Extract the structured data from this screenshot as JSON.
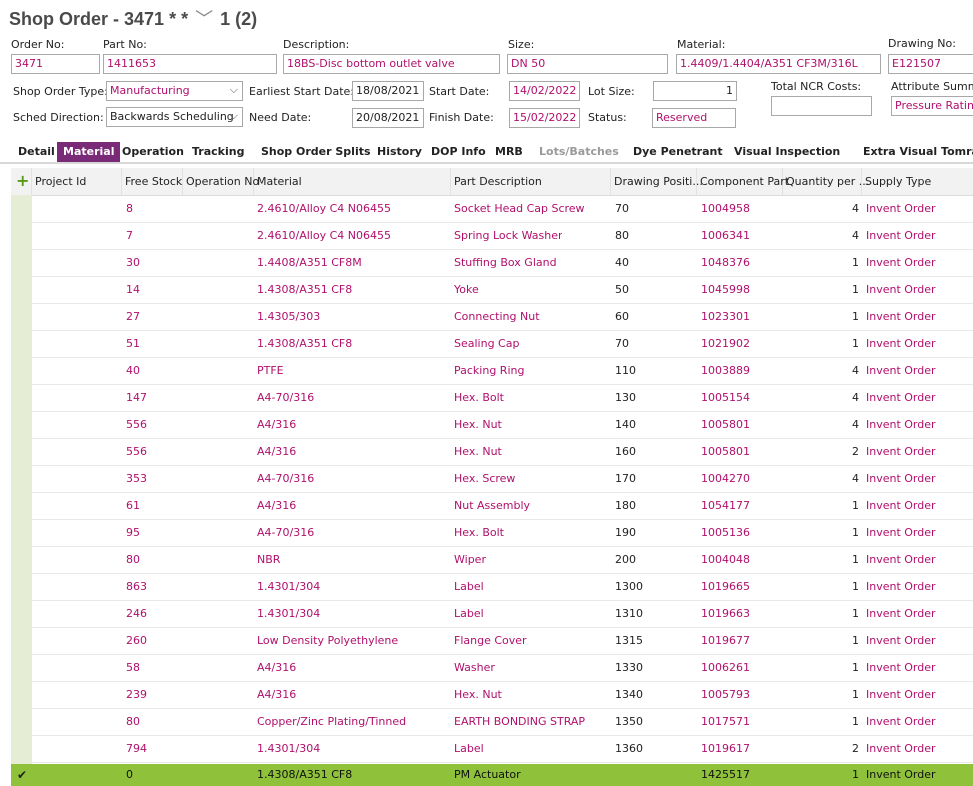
{
  "header": {
    "title": "Shop Order - 3471",
    "stars": "* *",
    "nav": "1 (2)"
  },
  "fields": {
    "order_no": {
      "label": "Order No:",
      "value": "3471"
    },
    "part_no": {
      "label": "Part No:",
      "value": "1411653"
    },
    "description": {
      "label": "Description:",
      "value": "18BS-Disc bottom outlet valve"
    },
    "size": {
      "label": "Size:",
      "value": "DN 50"
    },
    "material": {
      "label": "Material:",
      "value": "1.4409/1.4404/A351 CF3M/316L"
    },
    "drawing_no": {
      "label": "Drawing No:",
      "value": "E121507"
    },
    "shop_order_type": {
      "label": "Shop Order Type:",
      "value": "Manufacturing"
    },
    "earliest_start": {
      "label": "Earliest Start Date:",
      "value": "18/08/2021"
    },
    "start_date": {
      "label": "Start Date:",
      "value": "14/02/2022"
    },
    "lot_size": {
      "label": "Lot Size:",
      "value": "1"
    },
    "total_ncr": {
      "label": "Total NCR Costs:",
      "value": ""
    },
    "attribute_summary": {
      "label": "Attribute Summar",
      "value": "Pressure Rating"
    },
    "sched_direction": {
      "label": "Sched Direction:",
      "value": "Backwards Scheduling"
    },
    "need_date": {
      "label": "Need Date:",
      "value": "20/08/2021"
    },
    "finish_date": {
      "label": "Finish Date:",
      "value": "15/02/2022"
    },
    "status": {
      "label": "Status:",
      "value": "Reserved"
    }
  },
  "tabs": [
    "Detail",
    "Material",
    "Operation",
    "Tracking",
    "Shop Order Splits",
    "History",
    "DOP Info",
    "MRB",
    "Lots/Batches",
    "Dye Penetrant",
    "Visual Inspection",
    "Extra Visual Tomra C"
  ],
  "active_tab": "Material",
  "columns": [
    "Project Id",
    "Free Stock",
    "Operation No",
    "Material",
    "Part Description",
    "Drawing Positi...",
    "Component Part",
    "Quantity per ...",
    "Supply Type"
  ],
  "rows": [
    {
      "free": "8",
      "material": "2.4610/Alloy C4 N06455",
      "desc": "Socket Head Cap Screw",
      "pos": "70",
      "part": "1004958",
      "qty": "4",
      "supply": "Invent Order"
    },
    {
      "free": "7",
      "material": "2.4610/Alloy C4 N06455",
      "desc": "Spring Lock Washer",
      "pos": "80",
      "part": "1006341",
      "qty": "4",
      "supply": "Invent Order"
    },
    {
      "free": "30",
      "material": "1.4408/A351 CF8M",
      "desc": "Stuffing Box Gland",
      "pos": "40",
      "part": "1048376",
      "qty": "1",
      "supply": "Invent Order"
    },
    {
      "free": "14",
      "material": "1.4308/A351 CF8",
      "desc": "Yoke",
      "pos": "50",
      "part": "1045998",
      "qty": "1",
      "supply": "Invent Order"
    },
    {
      "free": "27",
      "material": "1.4305/303",
      "desc": "Connecting Nut",
      "pos": "60",
      "part": "1023301",
      "qty": "1",
      "supply": "Invent Order"
    },
    {
      "free": "51",
      "material": "1.4308/A351 CF8",
      "desc": "Sealing Cap",
      "pos": "70",
      "part": "1021902",
      "qty": "1",
      "supply": "Invent Order"
    },
    {
      "free": "40",
      "material": "PTFE",
      "desc": "Packing Ring",
      "pos": "110",
      "part": "1003889",
      "qty": "4",
      "supply": "Invent Order"
    },
    {
      "free": "147",
      "material": "A4-70/316",
      "desc": "Hex. Bolt",
      "pos": "130",
      "part": "1005154",
      "qty": "4",
      "supply": "Invent Order"
    },
    {
      "free": "556",
      "material": "A4/316",
      "desc": "Hex. Nut",
      "pos": "140",
      "part": "1005801",
      "qty": "4",
      "supply": "Invent Order"
    },
    {
      "free": "556",
      "material": "A4/316",
      "desc": "Hex. Nut",
      "pos": "160",
      "part": "1005801",
      "qty": "2",
      "supply": "Invent Order"
    },
    {
      "free": "353",
      "material": "A4-70/316",
      "desc": "Hex. Screw",
      "pos": "170",
      "part": "1004270",
      "qty": "4",
      "supply": "Invent Order"
    },
    {
      "free": "61",
      "material": "A4/316",
      "desc": "Nut Assembly",
      "pos": "180",
      "part": "1054177",
      "qty": "1",
      "supply": "Invent Order"
    },
    {
      "free": "95",
      "material": "A4-70/316",
      "desc": "Hex. Bolt",
      "pos": "190",
      "part": "1005136",
      "qty": "1",
      "supply": "Invent Order"
    },
    {
      "free": "80",
      "material": "NBR",
      "desc": "Wiper",
      "pos": "200",
      "part": "1004048",
      "qty": "1",
      "supply": "Invent Order"
    },
    {
      "free": "863",
      "material": "1.4301/304",
      "desc": "Label",
      "pos": "1300",
      "part": "1019665",
      "qty": "1",
      "supply": "Invent Order"
    },
    {
      "free": "246",
      "material": "1.4301/304",
      "desc": "Label",
      "pos": "1310",
      "part": "1019663",
      "qty": "1",
      "supply": "Invent Order"
    },
    {
      "free": "260",
      "material": "Low Density Polyethylene",
      "desc": "Flange Cover",
      "pos": "1315",
      "part": "1019677",
      "qty": "1",
      "supply": "Invent Order"
    },
    {
      "free": "58",
      "material": "A4/316",
      "desc": "Washer",
      "pos": "1330",
      "part": "1006261",
      "qty": "1",
      "supply": "Invent Order"
    },
    {
      "free": "239",
      "material": "A4/316",
      "desc": "Hex. Nut",
      "pos": "1340",
      "part": "1005793",
      "qty": "1",
      "supply": "Invent Order"
    },
    {
      "free": "80",
      "material": "Copper/Zinc Plating/Tinned",
      "desc": "EARTH BONDING STRAP",
      "pos": "1350",
      "part": "1017571",
      "qty": "1",
      "supply": "Invent Order"
    },
    {
      "free": "794",
      "material": "1.4301/304",
      "desc": "Label",
      "pos": "1360",
      "part": "1019617",
      "qty": "2",
      "supply": "Invent Order"
    }
  ],
  "selected_row": {
    "free": "0",
    "material": "1.4308/A351 CF8",
    "desc": "PM Actuator",
    "pos": "",
    "part": "1425517",
    "qty": "1",
    "supply": "Invent Order"
  },
  "colors": {
    "accent": "#7a2b78",
    "link": "#b0106c",
    "selected": "#8fc23a",
    "strip": "#e5edd5"
  }
}
